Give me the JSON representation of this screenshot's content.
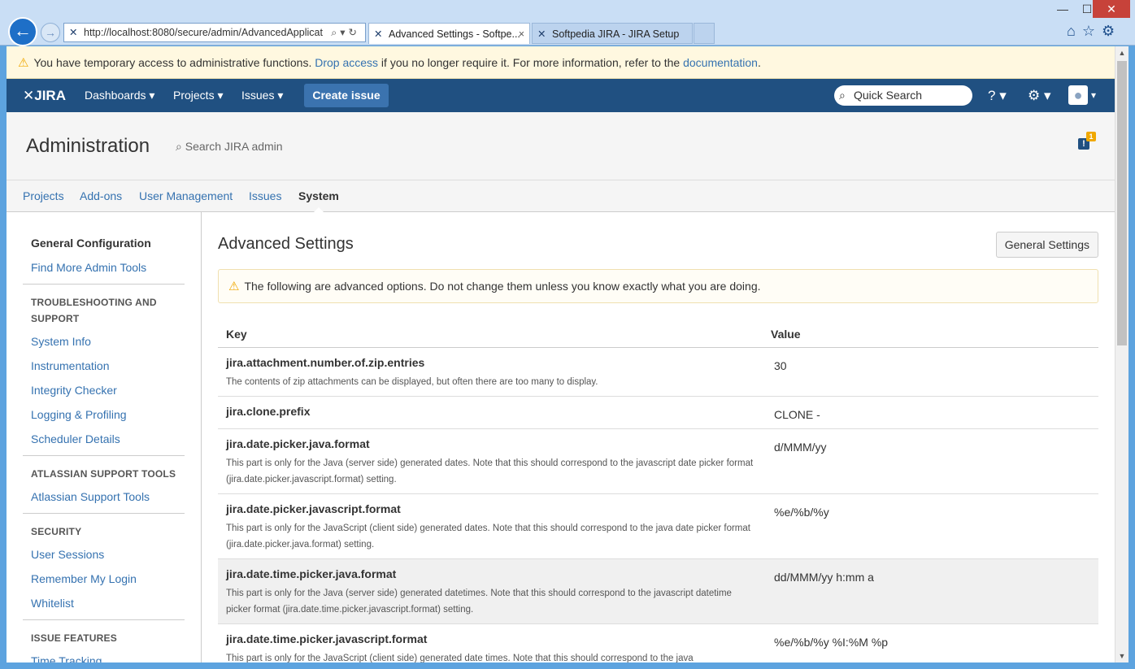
{
  "browser": {
    "url": "http://localhost:8080/secure/admin/AdvancedApplicat",
    "url_host": "localhost",
    "tabs": [
      {
        "title": "Advanced Settings - Softpe...",
        "active": true
      },
      {
        "title": "Softpedia JIRA - JIRA Setup",
        "active": false
      }
    ],
    "close_glyph": "×",
    "min_glyph": "—",
    "max_glyph": "☐",
    "close_window_glyph": "✕"
  },
  "notice": {
    "text_before": "You have temporary access to administrative functions. ",
    "link1": "Drop access",
    "text_middle": " if you no longer require it. For more information, refer to the ",
    "link2": "documentation",
    "text_after": "."
  },
  "topnav": {
    "logo": "JIRA",
    "dashboards": "Dashboards ▾",
    "projects": "Projects ▾",
    "issues": "Issues ▾",
    "create": "Create issue",
    "quick_search_placeholder": "Quick Search",
    "help_icon": "?",
    "colors": {
      "nav_bg": "#205081",
      "create_bg": "#3b73af"
    }
  },
  "admin": {
    "title": "Administration",
    "search_placeholder": "Search JIRA admin",
    "notification_count": "1",
    "tabs": [
      "Projects",
      "Add-ons",
      "User Management",
      "Issues",
      "System"
    ],
    "selected_tab": "System"
  },
  "sidebar": {
    "current": "General Configuration",
    "find_more": "Find More Admin Tools",
    "sections": [
      {
        "heading": "TROUBLESHOOTING AND SUPPORT",
        "items": [
          "System Info",
          "Instrumentation",
          "Integrity Checker",
          "Logging & Profiling",
          "Scheduler Details"
        ]
      },
      {
        "heading": "ATLASSIAN SUPPORT TOOLS",
        "items": [
          "Atlassian Support Tools"
        ]
      },
      {
        "heading": "SECURITY",
        "items": [
          "User Sessions",
          "Remember My Login",
          "Whitelist"
        ]
      },
      {
        "heading": "ISSUE FEATURES",
        "items": [
          "Time Tracking"
        ]
      }
    ]
  },
  "main": {
    "title": "Advanced Settings",
    "general_settings_button": "General Settings",
    "warning": "The following are advanced options. Do not change them unless you know exactly what you are doing.",
    "columns": {
      "key": "Key",
      "value": "Value"
    },
    "rows": [
      {
        "key": "jira.attachment.number.of.zip.entries",
        "desc": "The contents of zip attachments can be displayed, but often there are too many to display.",
        "value": "30"
      },
      {
        "key": "jira.clone.prefix",
        "desc": "",
        "value": "CLONE -"
      },
      {
        "key": "jira.date.picker.java.format",
        "desc": "This part is only for the Java (server side) generated dates. Note that this should correspond to the javascript date picker format (jira.date.picker.javascript.format) setting.",
        "value": "d/MMM/yy"
      },
      {
        "key": "jira.date.picker.javascript.format",
        "desc": "This part is only for the JavaScript (client side) generated dates. Note that this should correspond to the java date picker format (jira.date.picker.java.format) setting.",
        "value": "%e/%b/%y"
      },
      {
        "key": "jira.date.time.picker.java.format",
        "desc": "This part is only for the Java (server side) generated datetimes. Note that this should correspond to the javascript datetime picker format (jira.date.time.picker.javascript.format) setting.",
        "value": "dd/MMM/yy h:mm a"
      },
      {
        "key": "jira.date.time.picker.javascript.format",
        "desc": "This part is only for the JavaScript (client side) generated date times. Note that this should correspond to the java",
        "value": "%e/%b/%y %I:%M %p"
      }
    ]
  }
}
